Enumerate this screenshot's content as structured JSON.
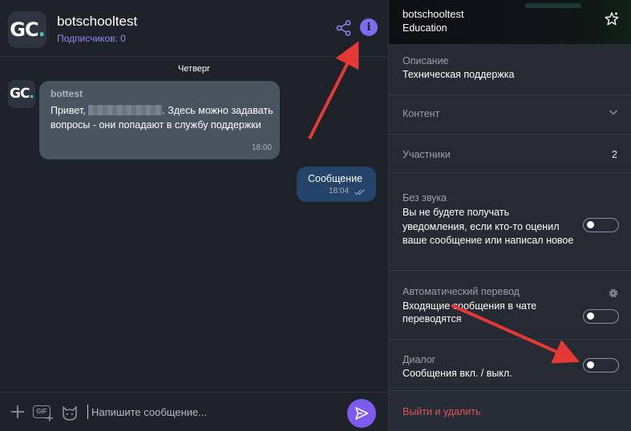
{
  "chat": {
    "title": "botschooltest",
    "subscribers": "Подписчиков: 0",
    "logo_text": "GC",
    "logo_dot": ".",
    "day": "Четверг",
    "incoming": {
      "sender": "bottest",
      "text_before": "Привет, ",
      "text_after": ". Здесь можно задавать вопросы - они попадают в службу поддержки",
      "time": "18:00"
    },
    "outgoing": {
      "text": "Сообщение",
      "time": "18:04"
    },
    "composer": {
      "placeholder": "Напишите сообщение...",
      "gif_label": "GIF"
    }
  },
  "info": {
    "name": "botschooltest",
    "category": "Education",
    "description_label": "Описание",
    "description_value": "Техническая поддержка",
    "content_label": "Контент",
    "participants_label": "Участники",
    "participants_count": "2",
    "mute_label": "Без звука",
    "mute_value": "Вы не будете получать уведомления, если кто-то оценил ваше сообщение или написал новое",
    "autotranslate_label": "Автоматический перевод",
    "autotranslate_value": "Входящие сообщения в чате переводятся",
    "dialog_label": "Диалог",
    "dialog_value": "Сообщения вкл. / выкл.",
    "leave_label": "Выйти и удалить"
  },
  "toggles": {
    "mute": false,
    "autotranslate": false,
    "dialog": false
  },
  "colors": {
    "accent": "#7d5af0",
    "link": "#8d8af0",
    "danger": "#e0535a",
    "annotation_arrow": "#e53935"
  },
  "icons": [
    "share-icon",
    "info-icon",
    "plus-icon",
    "gif-icon",
    "sticker-icon",
    "send-icon",
    "star-icon",
    "chevron-down-icon",
    "gear-icon",
    "double-check-icon"
  ]
}
